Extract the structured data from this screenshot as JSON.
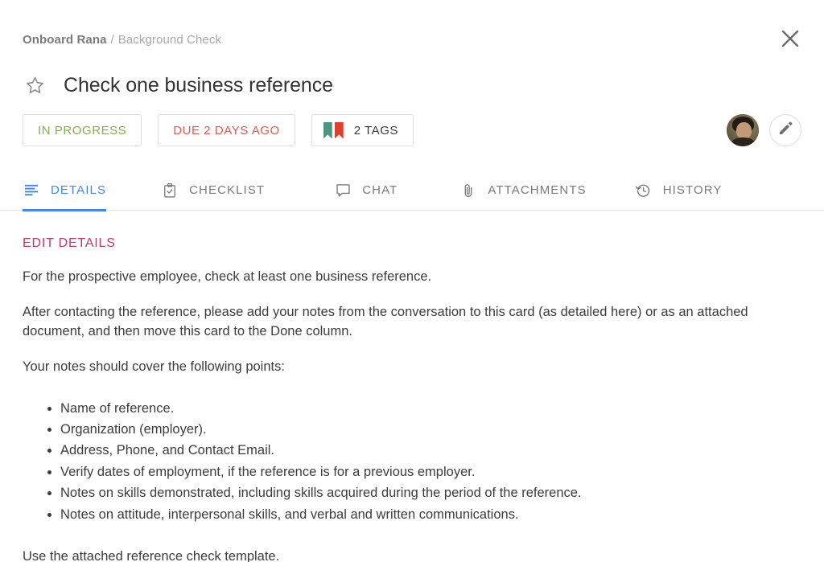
{
  "breadcrumb": {
    "primary": "Onboard Rana",
    "separator": "/",
    "secondary": "Background Check"
  },
  "header": {
    "close_icon": "close-icon",
    "star_icon": "star-outline-icon",
    "title": "Check one business reference"
  },
  "chips": {
    "status": {
      "label": "IN PROGRESS",
      "color": "#82b14e"
    },
    "due": {
      "label": "DUE 2 DAYS AGO",
      "color": "#e8574c"
    },
    "tags": {
      "label": "2 TAGS",
      "flags": [
        {
          "name": "tag-flag-green",
          "color": "#4d9483"
        },
        {
          "name": "tag-flag-red",
          "color": "#de3f2e"
        }
      ]
    }
  },
  "controls": {
    "avatar_name": "assignee-avatar",
    "edit_icon": "pencil-icon"
  },
  "tabs": [
    {
      "label": "DETAILS",
      "icon": "text-lines-icon",
      "active": true
    },
    {
      "label": "CHECKLIST",
      "icon": "clipboard-check-icon",
      "active": false
    },
    {
      "label": "CHAT",
      "icon": "speech-bubble-icon",
      "active": false
    },
    {
      "label": "ATTACHMENTS",
      "icon": "paperclip-icon",
      "active": false
    },
    {
      "label": "HISTORY",
      "icon": "clock-restore-icon",
      "active": false
    }
  ],
  "details": {
    "edit_link": "EDIT DETAILS",
    "paragraph1": "For the prospective employee, check at least one business reference.",
    "paragraph2": "After contacting the reference, please add your notes from the conversation to this card (as detailed here) or as an attached document, and then move this card to the Done column.",
    "paragraph3": "Your notes should cover the following points:",
    "bullets": [
      "Name of reference.",
      "Organization (employer).",
      "Address, Phone, and Contact Email.",
      "Verify dates of employment, if the reference is for a previous employer.",
      "Notes on skills demonstrated, including skills acquired during the period of the reference.",
      "Notes on attitude, interpersonal skills, and verbal and written communications."
    ],
    "closing": "Use the attached reference check template."
  },
  "colors": {
    "accent_blue": "#4285f4",
    "edit_pink": "#c2376b",
    "text": "#3c3c3c",
    "muted": "#7a7a7a"
  }
}
